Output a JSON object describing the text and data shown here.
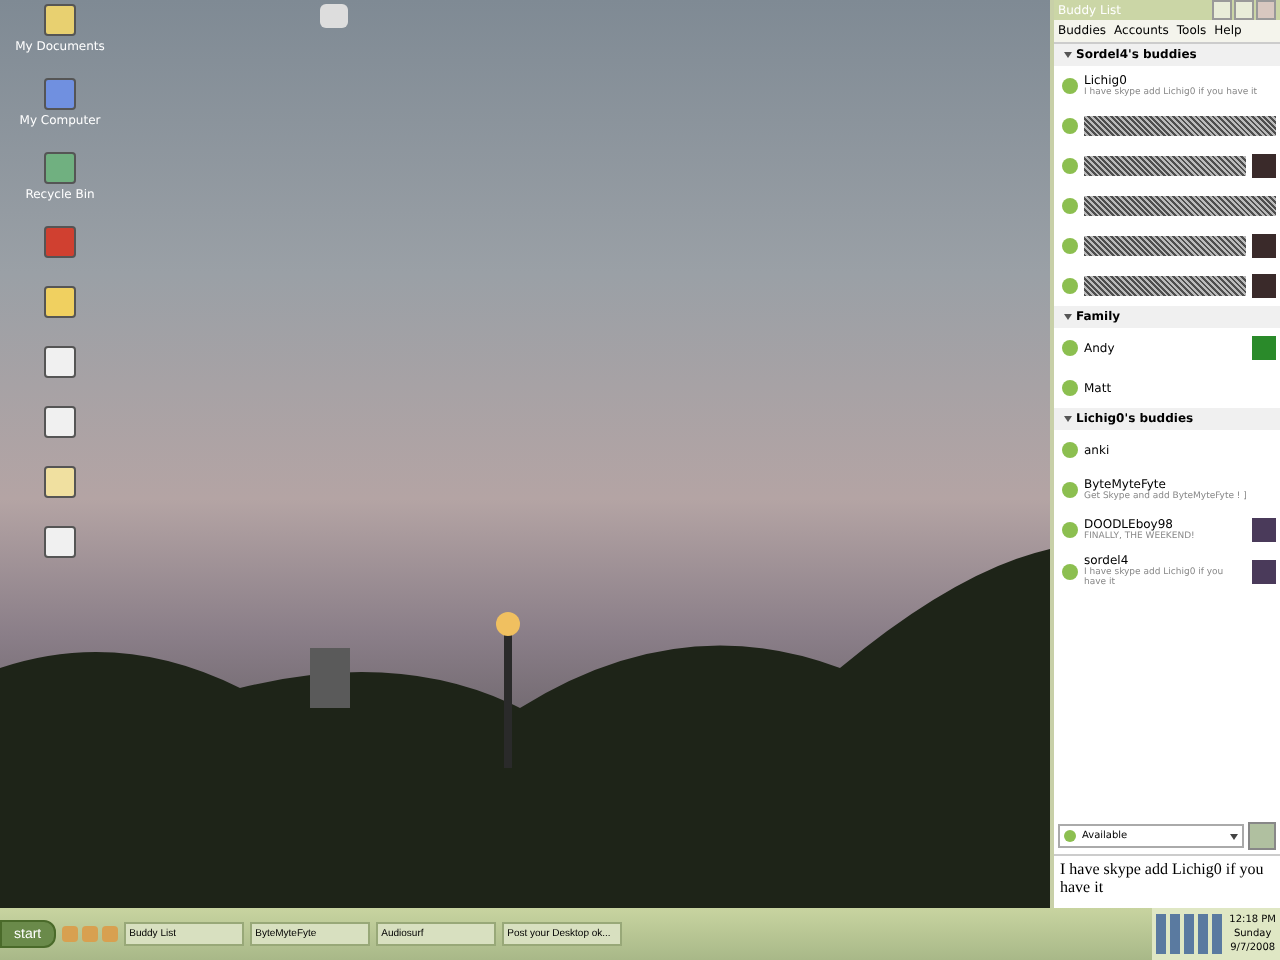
{
  "desktop": {
    "icons": [
      {
        "kind": "documents",
        "label": "My Documents"
      },
      {
        "kind": "computer",
        "label": "My Computer"
      },
      {
        "kind": "recycle",
        "label": "Recycle Bin"
      },
      {
        "kind": "tiles"
      },
      {
        "kind": "folder"
      },
      {
        "kind": "file"
      },
      {
        "kind": "file"
      },
      {
        "kind": "app"
      },
      {
        "kind": "file"
      }
    ]
  },
  "buddy_window": {
    "title": "Buddy List",
    "menu": [
      "Buddies",
      "Accounts",
      "Tools",
      "Help"
    ],
    "groups": [
      {
        "name": "Sordel4's buddies",
        "expanded": true,
        "buddies": [
          {
            "kind": "buddy",
            "name": "Lichig0",
            "message": "I have skype add Lichig0 if you have it"
          },
          {
            "kind": "scribbled"
          },
          {
            "kind": "scribbled",
            "avatar": true
          },
          {
            "kind": "scribbled"
          },
          {
            "kind": "scribbled",
            "avatar": true
          },
          {
            "kind": "scribbled",
            "avatar": true
          }
        ]
      },
      {
        "name": "Family",
        "expanded": true,
        "buddies": [
          {
            "kind": "buddy",
            "name": "Andy",
            "avatar": true
          },
          {
            "kind": "buddy",
            "name": "Matt"
          }
        ]
      },
      {
        "name": "Lichig0's buddies",
        "expanded": true,
        "buddies": [
          {
            "kind": "buddy",
            "name": "anki"
          },
          {
            "kind": "buddy",
            "name": "ByteMyteFyte",
            "message": "Get Skype and add ByteMyteFyte ! ]"
          },
          {
            "kind": "buddy",
            "name": "DOODLEboy98",
            "message": "FINALLY, THE WEEKEND!",
            "avatar": true
          },
          {
            "kind": "buddy",
            "name": "sordel4",
            "message": "I have skype add Lichig0 if you have it",
            "avatar": true
          }
        ]
      }
    ],
    "status": "Available",
    "status_message": "I have skype add Lichig0 if you have it"
  },
  "taskbar": {
    "start": "start",
    "tasks": [
      "Buddy List",
      "ByteMyteFyte",
      "Audiosurf",
      "Post your Desktop ok..."
    ],
    "clock": {
      "time": "12:18 PM",
      "day": "Sunday",
      "date": "9/7/2008"
    }
  }
}
